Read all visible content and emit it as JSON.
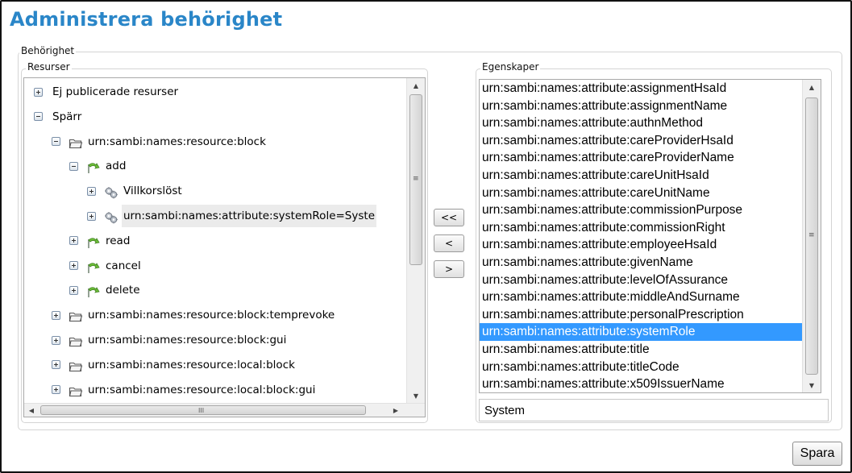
{
  "page": {
    "title": "Administrera behörighet"
  },
  "sections": {
    "outer_legend": "Behörighet",
    "resources_legend": "Resurser",
    "properties_legend": "Egenskaper"
  },
  "tree": {
    "items": [
      {
        "label": "Ej publicerade resurser",
        "toggle": "plus",
        "icon": "none"
      },
      {
        "label": "Spärr",
        "toggle": "minus",
        "icon": "none"
      },
      {
        "label": "urn:sambi:names:resource:block",
        "toggle": "minus",
        "icon": "folder-icon"
      },
      {
        "label": "add",
        "toggle": "minus",
        "icon": "action-arrow-icon"
      },
      {
        "label": "Villkorslöst",
        "toggle": "plus",
        "icon": "gear-cluster-icon"
      },
      {
        "label": "urn:sambi:names:attribute:systemRole=Syste",
        "toggle": "plus",
        "icon": "gear-cluster-icon",
        "selected": true
      },
      {
        "label": "read",
        "toggle": "plus",
        "icon": "action-arrow-icon"
      },
      {
        "label": "cancel",
        "toggle": "plus",
        "icon": "action-arrow-icon"
      },
      {
        "label": "delete",
        "toggle": "plus",
        "icon": "action-arrow-icon"
      },
      {
        "label": "urn:sambi:names:resource:block:temprevoke",
        "toggle": "plus",
        "icon": "folder-icon"
      },
      {
        "label": "urn:sambi:names:resource:block:gui",
        "toggle": "plus",
        "icon": "folder-icon"
      },
      {
        "label": "urn:sambi:names:resource:local:block",
        "toggle": "plus",
        "icon": "folder-icon"
      },
      {
        "label": "urn:sambi:names:resource:local:block:gui",
        "toggle": "plus",
        "icon": "folder-icon"
      }
    ],
    "hscroll_grip": "III"
  },
  "buttons": {
    "move_all_left": "<<",
    "move_left": "<",
    "move_right": ">",
    "save": "Spara"
  },
  "properties": {
    "items": [
      "urn:sambi:names:attribute:assignmentHsaId",
      "urn:sambi:names:attribute:assignmentName",
      "urn:sambi:names:attribute:authnMethod",
      "urn:sambi:names:attribute:careProviderHsaId",
      "urn:sambi:names:attribute:careProviderName",
      "urn:sambi:names:attribute:careUnitHsaId",
      "urn:sambi:names:attribute:careUnitName",
      "urn:sambi:names:attribute:commissionPurpose",
      "urn:sambi:names:attribute:commissionRight",
      "urn:sambi:names:attribute:employeeHsaId",
      "urn:sambi:names:attribute:givenName",
      "urn:sambi:names:attribute:levelOfAssurance",
      "urn:sambi:names:attribute:middleAndSurname",
      "urn:sambi:names:attribute:personalPrescription",
      "urn:sambi:names:attribute:systemRole",
      "urn:sambi:names:attribute:title",
      "urn:sambi:names:attribute:titleCode",
      "urn:sambi:names:attribute:x509IssuerName"
    ],
    "selected_index": 14,
    "value": "System"
  },
  "colors": {
    "title": "#2a86c8",
    "selection": "#3399ff"
  }
}
